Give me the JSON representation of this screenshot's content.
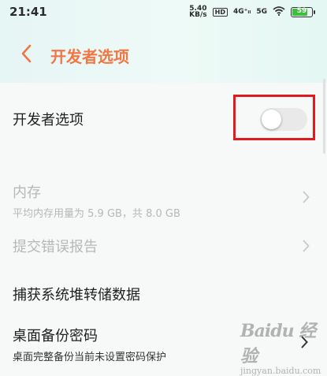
{
  "status_bar": {
    "time": "21:41",
    "net_speed_value": "5.40",
    "net_speed_unit": "KB/s",
    "hd_badge": "HD",
    "sim2": "4G⁺ᵢₗ",
    "sim1": "5G",
    "battery_level": "59",
    "battery_color": "#3dbf3d"
  },
  "header": {
    "back_icon": "chevron-left-icon",
    "title": "开发者选项",
    "accent_color": "#f07744"
  },
  "developer_toggle": {
    "label": "开发者选项",
    "state": "off",
    "highlight_color": "#e0191f"
  },
  "items": [
    {
      "title": "内存",
      "subtitle": "平均内存用量为 5.9 GB，共 8.0 GB",
      "enabled": false,
      "icon": "chevron-right-icon"
    },
    {
      "title": "提交错误报告",
      "enabled": false,
      "icon": "chevron-right-icon"
    },
    {
      "title": "捕获系统堆转储数据",
      "enabled": true
    },
    {
      "title": "桌面备份密码",
      "subtitle": "桌面完整备份当前未设置密码保护",
      "enabled": true,
      "icon": "chevron-right-icon"
    }
  ],
  "watermark": {
    "brand": "Baidu 经验",
    "url": "jingyan.baidu.com"
  }
}
